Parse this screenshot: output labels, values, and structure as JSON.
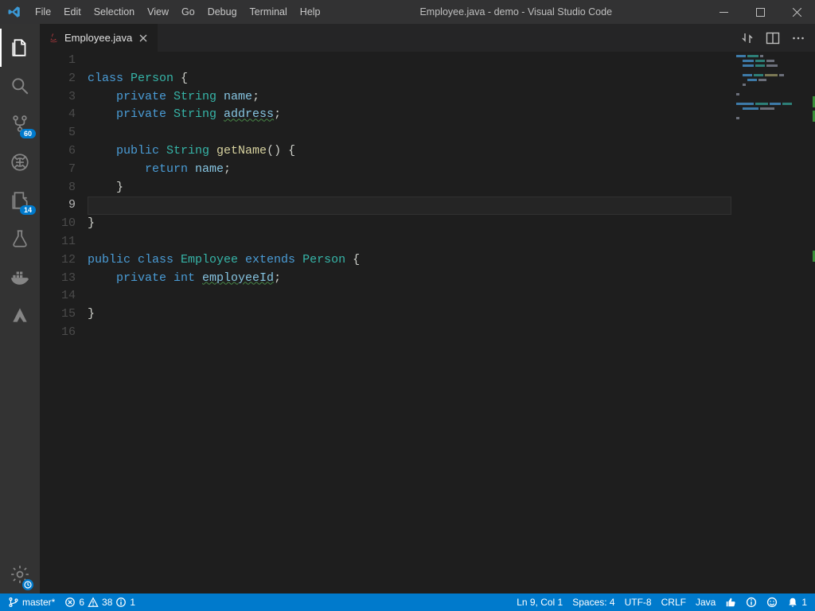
{
  "window": {
    "title": "Employee.java - demo - Visual Studio Code"
  },
  "menu": {
    "file": "File",
    "edit": "Edit",
    "selection": "Selection",
    "view": "View",
    "go": "Go",
    "debug": "Debug",
    "terminal": "Terminal",
    "help": "Help"
  },
  "activity": {
    "scm_badge": "60",
    "test_badge": "14"
  },
  "tabs": {
    "active": {
      "label": "Employee.java",
      "icon": "java"
    }
  },
  "editor": {
    "line_numbers": [
      "1",
      "2",
      "3",
      "4",
      "5",
      "6",
      "7",
      "8",
      "9",
      "10",
      "11",
      "12",
      "13",
      "14",
      "15",
      "16"
    ],
    "current_line_index": 8,
    "code": {
      "l2": {
        "kw1": "class ",
        "type": "Person ",
        "p": "{"
      },
      "l3": {
        "kw1": "private ",
        "type": "String ",
        "var": "name",
        "p": ";"
      },
      "l4": {
        "kw1": "private ",
        "type": "String ",
        "var": "address",
        "p": ";"
      },
      "l6": {
        "kw1": "public ",
        "type": "String ",
        "fn": "getName",
        "p1": "()",
        " p2": " {"
      },
      "l7": {
        "kw1": "return ",
        "var": "name",
        "p": ";"
      },
      "l8": {
        "p": "}"
      },
      "l10": {
        "p": "}"
      },
      "l12": {
        "kw1": "public ",
        "kw2": "class ",
        "type1": "Employee ",
        "kw3": "extends ",
        "type2": "Person ",
        "p": "{"
      },
      "l13": {
        "kw1": "private ",
        "type": "int ",
        "var": "employeeId",
        "p": ";"
      },
      "l15": {
        "p": "}"
      }
    }
  },
  "status": {
    "branch": "master*",
    "errors": "6",
    "warnings": "38",
    "info": "1",
    "cursor": "Ln 9, Col 1",
    "spaces": "Spaces: 4",
    "encoding": "UTF-8",
    "eol": "CRLF",
    "language": "Java",
    "notifications": "1"
  }
}
